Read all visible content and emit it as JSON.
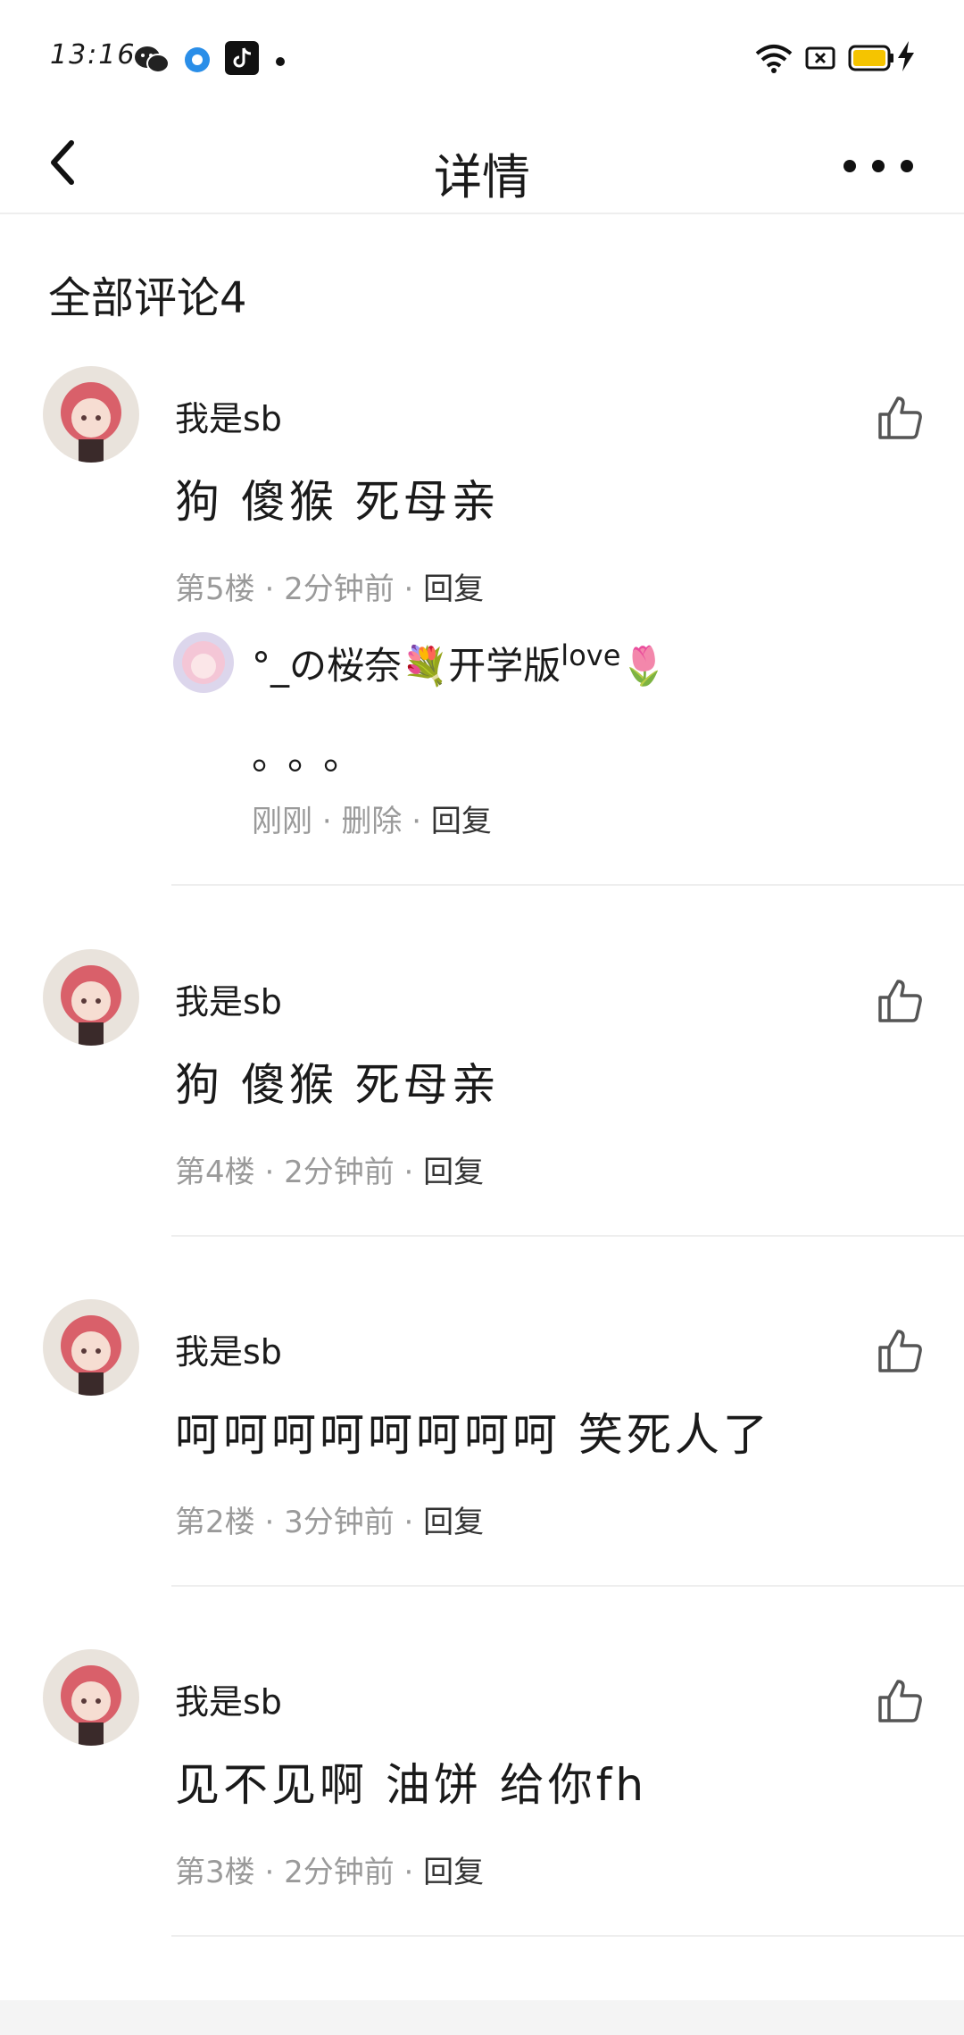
{
  "status_bar": {
    "time": "13:16",
    "icons": [
      "wechat-icon",
      "qq-browser-icon",
      "tiktok-icon",
      "notification-dot-icon",
      "wifi-icon",
      "sim-icon",
      "battery-icon",
      "charging-icon"
    ],
    "battery_color": "#f5c400"
  },
  "nav": {
    "title": "详情",
    "back_icon": "back-arrow-icon",
    "more_icon": "more-icon"
  },
  "section": {
    "title": "全部评论4"
  },
  "comments": [
    {
      "user": "我是sb",
      "text": "狗 傻猴 死母亲",
      "floor": "第5楼",
      "sep1": "·",
      "time": "2分钟前",
      "sep2": "·",
      "reply": "回复",
      "sub": {
        "user": "°_の桜奈💐开学版",
        "user_suffix": "love",
        "user_emoji": "🌷",
        "text": "。。。",
        "time": "刚刚",
        "sep1": "·",
        "delete": "删除",
        "sep2": "·",
        "reply": "回复"
      }
    },
    {
      "user": "我是sb",
      "text": "狗 傻猴 死母亲",
      "floor": "第4楼",
      "sep1": "·",
      "time": "2分钟前",
      "sep2": "·",
      "reply": "回复"
    },
    {
      "user": "我是sb",
      "text": "呵呵呵呵呵呵呵呵 笑死人了",
      "floor": "第2楼",
      "sep1": "·",
      "time": "3分钟前",
      "sep2": "·",
      "reply": "回复"
    },
    {
      "user": "我是sb",
      "text": "见不见啊 油饼 给你fh",
      "floor": "第3楼",
      "sep1": "·",
      "time": "2分钟前",
      "sep2": "·",
      "reply": "回复"
    }
  ],
  "colors": {
    "accent_text": "#1a1a1a",
    "meta_text": "#9a9a9a",
    "divider": "#eeeeee",
    "avatar_hair": "#d9606a"
  }
}
